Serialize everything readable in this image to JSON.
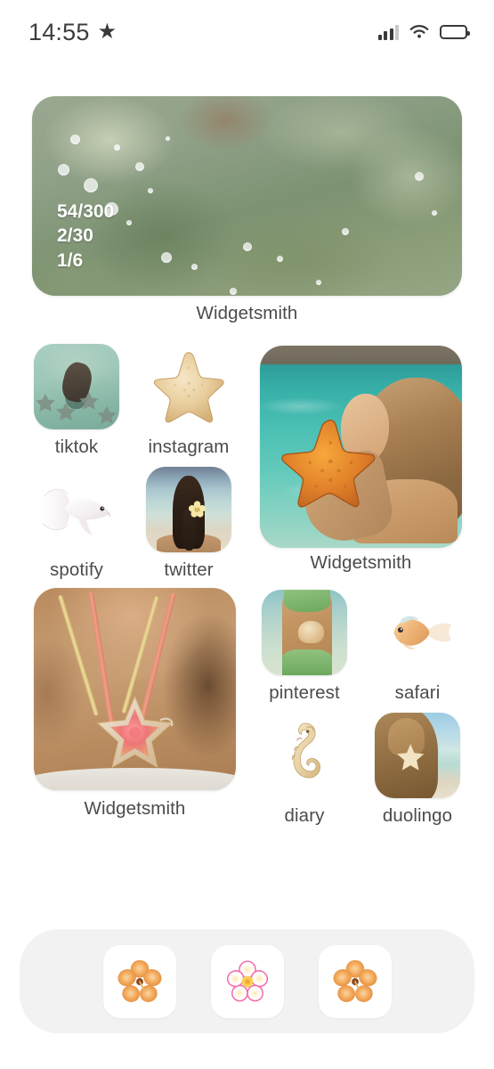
{
  "status_bar": {
    "time": "14:55",
    "star_icon": "star-icon",
    "signal_icon": "cellular-signal-icon",
    "signal_bars_filled": 3,
    "signal_bars_total": 4,
    "wifi_icon": "wifi-icon",
    "battery_icon": "battery-icon",
    "battery_level_percent": 55
  },
  "theme": {
    "background": "#ffffff",
    "label_color": "#4b4b4b",
    "dock_background": "#f2f2f2",
    "dock_icon_background": "#ffffff",
    "widget_overlay_text_color": "#ffffff"
  },
  "widgets": [
    {
      "id": "widget-algae",
      "label": "Widgetsmith",
      "size": "large-wide",
      "art": "underwater-algae-photo",
      "overlay_lines": [
        "54/300",
        "2/30",
        "1/6"
      ]
    },
    {
      "id": "widget-starfish-girl",
      "label": "Widgetsmith",
      "size": "medium-square",
      "art": "girl-holding-orange-starfish-in-pool"
    },
    {
      "id": "widget-necklace",
      "label": "Widgetsmith",
      "size": "medium-square",
      "art": "starfish-glass-pendant-necklace"
    }
  ],
  "apps": [
    {
      "id": "app-tiktok",
      "label": "tiktok",
      "icon_style": "photo",
      "art": "person-in-green-water-with-starfish"
    },
    {
      "id": "app-instagram",
      "label": "instagram",
      "icon_style": "transparent",
      "art": "starfish-icon"
    },
    {
      "id": "app-spotify",
      "label": "spotify",
      "icon_style": "transparent",
      "art": "white-betta-fish-icon"
    },
    {
      "id": "app-twitter",
      "label": "twitter",
      "icon_style": "photo",
      "art": "girl-with-braid-and-flower-at-beach"
    },
    {
      "id": "app-pinterest",
      "label": "pinterest",
      "icon_style": "photo",
      "art": "girl-in-green-bikini-holding-shell"
    },
    {
      "id": "app-safari",
      "label": "safari",
      "icon_style": "transparent",
      "art": "goldfish-icon"
    },
    {
      "id": "app-diary",
      "label": "diary",
      "icon_style": "transparent",
      "art": "seahorse-icon"
    },
    {
      "id": "app-duolingo",
      "label": "duolingo",
      "icon_style": "photo",
      "art": "hair-with-starfish-clip-at-beach"
    }
  ],
  "dock": {
    "items": [
      {
        "id": "dock-item-1",
        "icon": "hibiscus-flower-icon",
        "color": "#f0a04b"
      },
      {
        "id": "dock-item-2",
        "icon": "plumeria-flower-icon",
        "color": "#f06eb0"
      },
      {
        "id": "dock-item-3",
        "icon": "hibiscus-flower-icon",
        "color": "#f0a04b"
      }
    ]
  }
}
